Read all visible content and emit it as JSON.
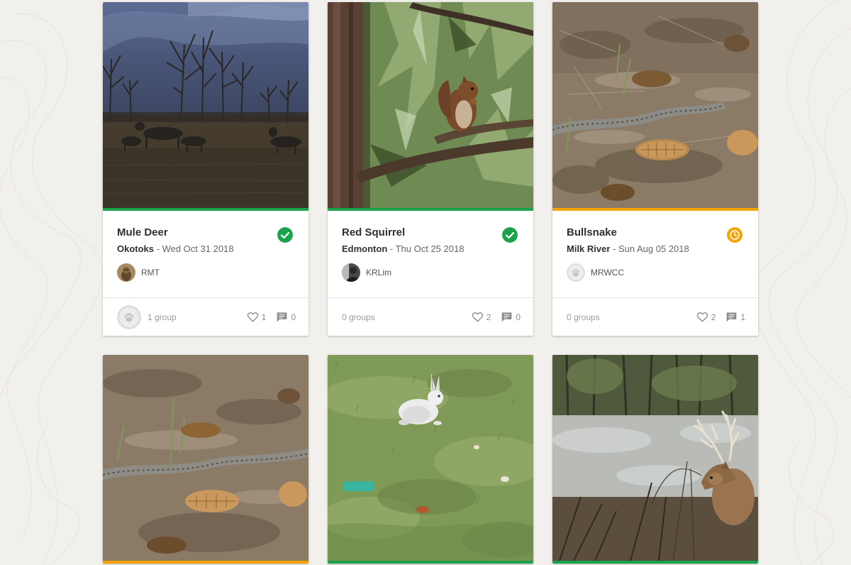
{
  "observations": [
    {
      "title": "Mule Deer",
      "location": "Okotoks",
      "date": "Wed Oct 31 2018",
      "user": "RMT",
      "groups": "1 group",
      "likes": "1",
      "comments": "0",
      "status": "verified",
      "status_color": "#1aa34a",
      "photo": "mule-deer-photo"
    },
    {
      "title": "Red Squirrel",
      "location": "Edmonton",
      "date": "Thu Oct 25 2018",
      "user": "KRLim",
      "groups": "0 groups",
      "likes": "2",
      "comments": "0",
      "status": "verified",
      "status_color": "#1aa34a",
      "photo": "red-squirrel-photo"
    },
    {
      "title": "Bullsnake",
      "location": "Milk River",
      "date": "Sun Aug 05 2018",
      "user": "MRWCC",
      "groups": "0 groups",
      "likes": "2",
      "comments": "1",
      "status": "pending",
      "status_color": "#f5a300",
      "photo": "bullsnake-photo"
    },
    {
      "status_color": "#f5a300",
      "photo": "bullsnake-closeup-photo"
    },
    {
      "status_color": "#1aa34a",
      "photo": "snowshoe-hare-photo"
    },
    {
      "status_color": "#1aa34a",
      "photo": "white-tailed-deer-photo"
    }
  ],
  "separator": " - "
}
